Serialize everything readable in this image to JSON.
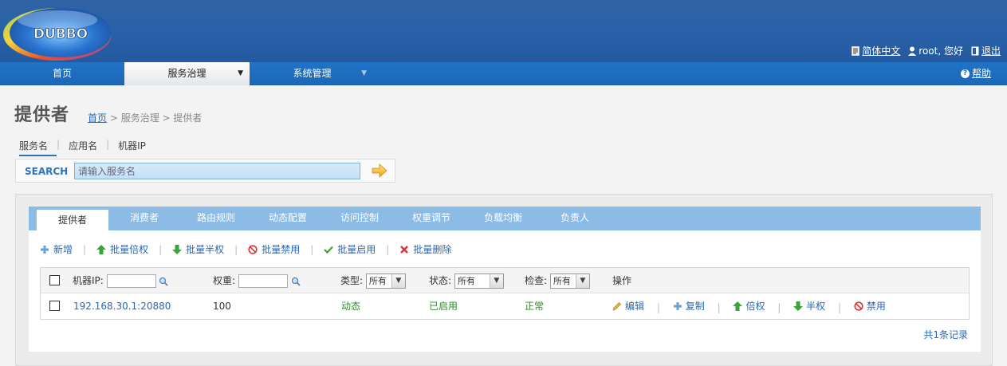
{
  "header": {
    "logo_text": "DUBBO",
    "language": "简体中文",
    "user": "root, 您好",
    "logout": "退出"
  },
  "nav": {
    "items": [
      {
        "label": "首页"
      },
      {
        "label": "服务治理"
      },
      {
        "label": "系统管理"
      }
    ],
    "help": "帮助"
  },
  "page": {
    "title": "提供者",
    "breadcrumb": {
      "home": "首页",
      "rest": " > 服务治理 > 提供者"
    }
  },
  "search": {
    "tabs": [
      "服务名",
      "应用名",
      "机器IP"
    ],
    "label": "SEARCH",
    "placeholder": "请输入服务名"
  },
  "tabs": [
    "提供者",
    "消费者",
    "路由规则",
    "动态配置",
    "访问控制",
    "权重调节",
    "负载均衡",
    "负责人"
  ],
  "actions": {
    "add": "新增",
    "batch_double": "批量倍权",
    "batch_half": "批量半权",
    "batch_disable": "批量禁用",
    "batch_enable": "批量启用",
    "batch_delete": "批量删除"
  },
  "table": {
    "headers": {
      "ip": "机器IP:",
      "weight": "权重:",
      "type": "类型:",
      "status": "状态:",
      "check": "检查:",
      "ops": "操作"
    },
    "filters": {
      "type": "所有",
      "status": "所有",
      "check": "所有"
    },
    "rows": [
      {
        "ip": "192.168.30.1:20880",
        "weight": "100",
        "type": "动态",
        "status": "已启用",
        "check": "正常",
        "ops": {
          "edit": "编辑",
          "copy": "复制",
          "double": "倍权",
          "half": "半权",
          "disable": "禁用"
        }
      }
    ],
    "total": "共1条记录"
  },
  "colors": {
    "header_bg": "#2860a8",
    "nav_bg": "#1f6ec0",
    "tabbar_bg": "#8cbbe6",
    "link": "#2a68b5",
    "green": "#2e8b2e"
  }
}
